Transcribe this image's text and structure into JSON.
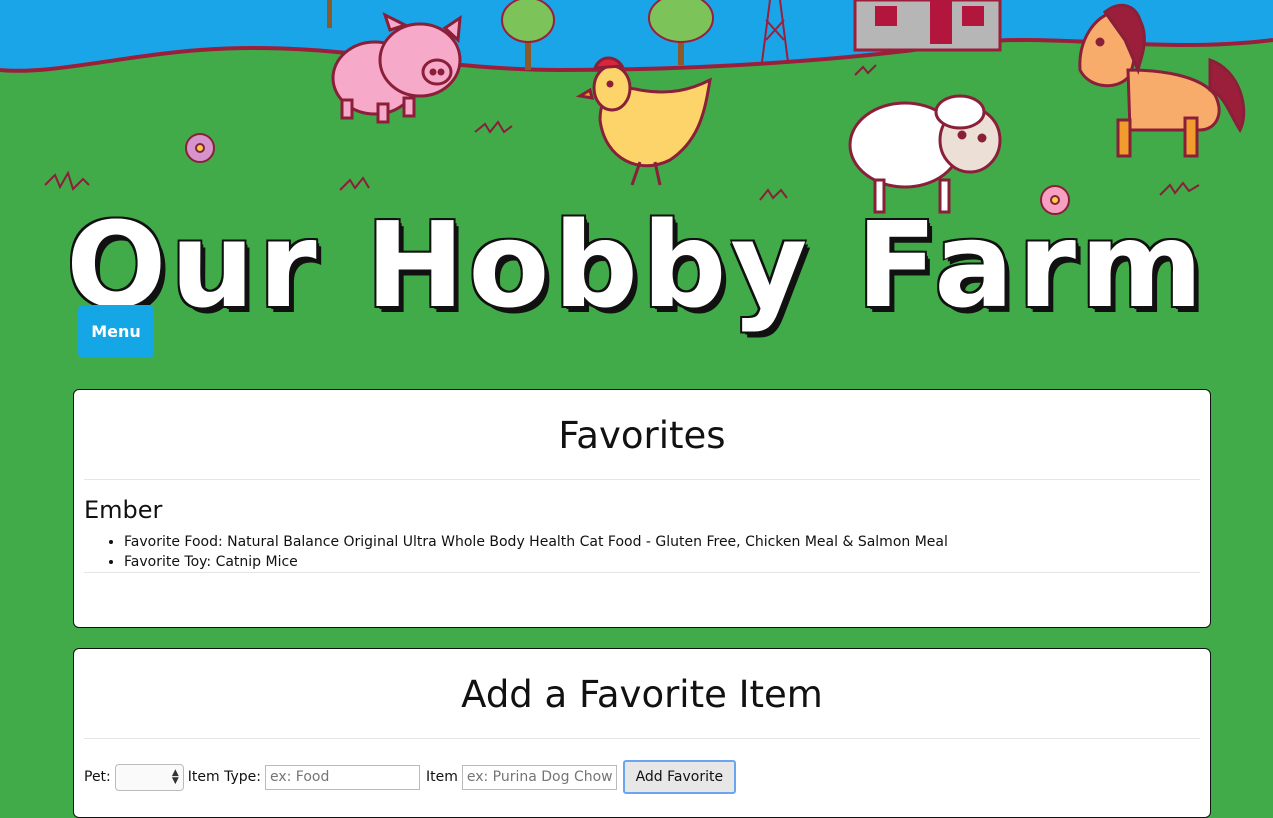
{
  "header": {
    "title": "Our Hobby Farm",
    "menu_label": "Menu"
  },
  "favorites": {
    "heading": "Favorites",
    "pets": [
      {
        "name": "Ember",
        "items": [
          "Favorite Food: Natural Balance Original Ultra Whole Body Health Cat Food - Gluten Free, Chicken Meal & Salmon Meal",
          "Favorite Toy: Catnip Mice"
        ]
      }
    ]
  },
  "add_form": {
    "heading": "Add a Favorite Item",
    "pet_label": "Pet:",
    "pet_value": "",
    "type_label": "Item Type:",
    "type_placeholder": "ex: Food",
    "item_label": "Item",
    "item_placeholder": "ex: Purina Dog Chow",
    "submit_label": "Add Favorite"
  },
  "colors": {
    "sky": "#1aa5e8",
    "grass": "#42ab49",
    "menu_button": "#15a6e6"
  },
  "icons": [
    "pig-illustration",
    "chicken-illustration",
    "sheep-illustration",
    "horse-illustration",
    "barn-illustration",
    "tree-illustration",
    "flower-illustration"
  ]
}
